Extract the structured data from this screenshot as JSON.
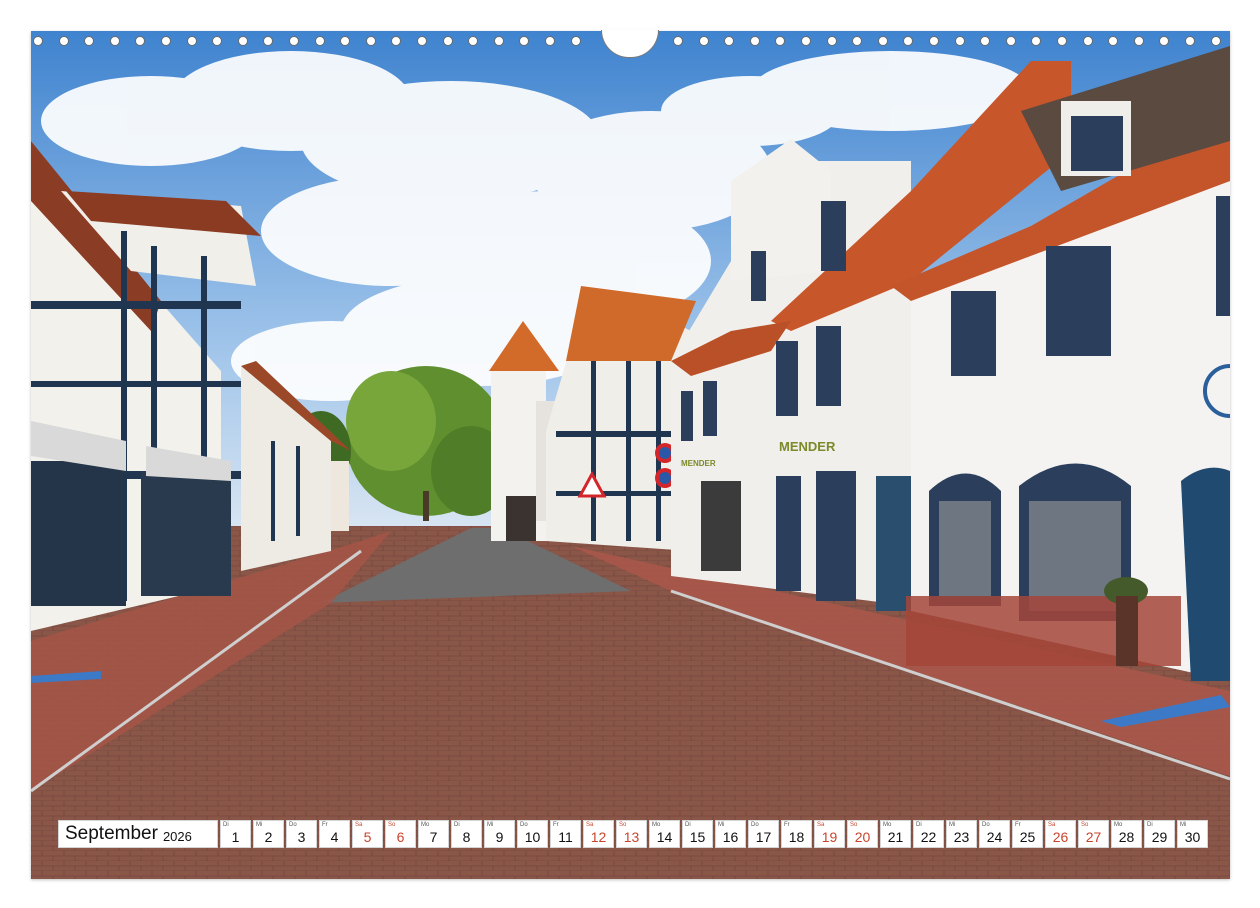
{
  "calendar": {
    "month": "September",
    "year": "2026",
    "weekend_color": "#c8452c",
    "days": [
      {
        "abbr": "Di",
        "num": "1",
        "weekend": false
      },
      {
        "abbr": "Mi",
        "num": "2",
        "weekend": false
      },
      {
        "abbr": "Do",
        "num": "3",
        "weekend": false
      },
      {
        "abbr": "Fr",
        "num": "4",
        "weekend": false
      },
      {
        "abbr": "Sa",
        "num": "5",
        "weekend": true
      },
      {
        "abbr": "So",
        "num": "6",
        "weekend": true
      },
      {
        "abbr": "Mo",
        "num": "7",
        "weekend": false
      },
      {
        "abbr": "Di",
        "num": "8",
        "weekend": false
      },
      {
        "abbr": "Mi",
        "num": "9",
        "weekend": false
      },
      {
        "abbr": "Do",
        "num": "10",
        "weekend": false
      },
      {
        "abbr": "Fr",
        "num": "11",
        "weekend": false
      },
      {
        "abbr": "Sa",
        "num": "12",
        "weekend": true
      },
      {
        "abbr": "So",
        "num": "13",
        "weekend": true
      },
      {
        "abbr": "Mo",
        "num": "14",
        "weekend": false
      },
      {
        "abbr": "Di",
        "num": "15",
        "weekend": false
      },
      {
        "abbr": "Mi",
        "num": "16",
        "weekend": false
      },
      {
        "abbr": "Do",
        "num": "17",
        "weekend": false
      },
      {
        "abbr": "Fr",
        "num": "18",
        "weekend": false
      },
      {
        "abbr": "Sa",
        "num": "19",
        "weekend": true
      },
      {
        "abbr": "So",
        "num": "20",
        "weekend": true
      },
      {
        "abbr": "Mo",
        "num": "21",
        "weekend": false
      },
      {
        "abbr": "Di",
        "num": "22",
        "weekend": false
      },
      {
        "abbr": "Mi",
        "num": "23",
        "weekend": false
      },
      {
        "abbr": "Do",
        "num": "24",
        "weekend": false
      },
      {
        "abbr": "Fr",
        "num": "25",
        "weekend": false
      },
      {
        "abbr": "Sa",
        "num": "26",
        "weekend": true
      },
      {
        "abbr": "So",
        "num": "27",
        "weekend": true
      },
      {
        "abbr": "Mo",
        "num": "28",
        "weekend": false
      },
      {
        "abbr": "Di",
        "num": "29",
        "weekend": false
      },
      {
        "abbr": "Mi",
        "num": "30",
        "weekend": false
      }
    ]
  },
  "photo": {
    "shop_sign": "MENDER",
    "shop_sign_small": "MENDER"
  },
  "colors": {
    "sky": "#4f8fd4",
    "pavement": "#8f5a4c",
    "roof": "#c05a2a",
    "timber": "#1f3550"
  }
}
